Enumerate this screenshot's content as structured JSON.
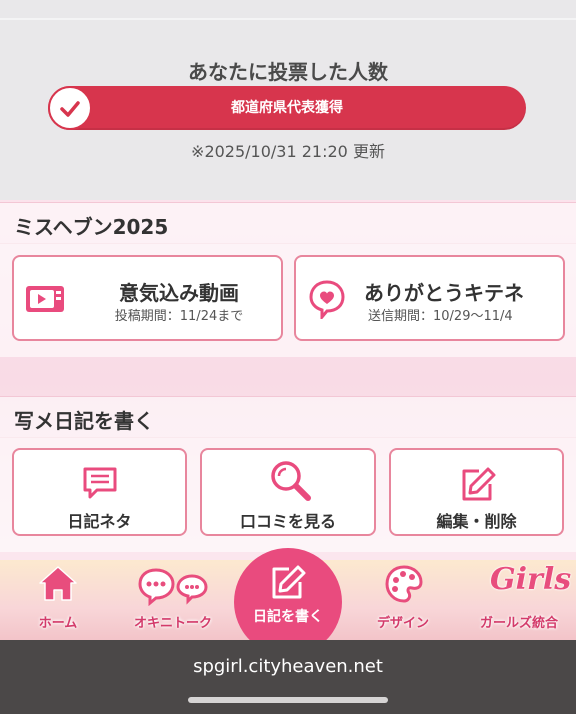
{
  "vote": {
    "title": "あなたに投票した人数",
    "bar_label": "都道府県代表獲得",
    "updated": "※2025/10/31 21:20 更新"
  },
  "miss_heaven": {
    "title": "ミスヘブン2025",
    "cards": [
      {
        "title": "意気込み動画",
        "sub": "投稿期間：11/24まで",
        "icon": "video-icon"
      },
      {
        "title": "ありがとうキテネ",
        "sub": "送信期間：10/29〜11/4",
        "icon": "heart-bubble-icon"
      }
    ]
  },
  "diary": {
    "title": "写メ日記を書く",
    "buttons": [
      {
        "label": "日記ネタ",
        "icon": "speech-bubble-icon"
      },
      {
        "label": "口コミを見る",
        "icon": "magnifier-icon"
      },
      {
        "label": "編集・削除",
        "icon": "edit-icon"
      }
    ]
  },
  "tabbar": {
    "items": [
      {
        "label": "ホーム",
        "icon": "home-icon"
      },
      {
        "label": "オキニトーク",
        "icon": "chat-bubbles-icon"
      },
      {
        "label": "日記を書く",
        "icon": "write-icon"
      },
      {
        "label": "デザイン",
        "icon": "palette-icon"
      },
      {
        "label": "ガールズ統合",
        "icon": "girls-logo-icon"
      }
    ],
    "logo_text": "Girls"
  },
  "browser": {
    "url": "spgirl.cityheaven.net"
  },
  "colors": {
    "accent": "#d7354d",
    "pink": "#e94b7e",
    "card_border": "#e8869d",
    "browser_bar": "#4b4848"
  }
}
